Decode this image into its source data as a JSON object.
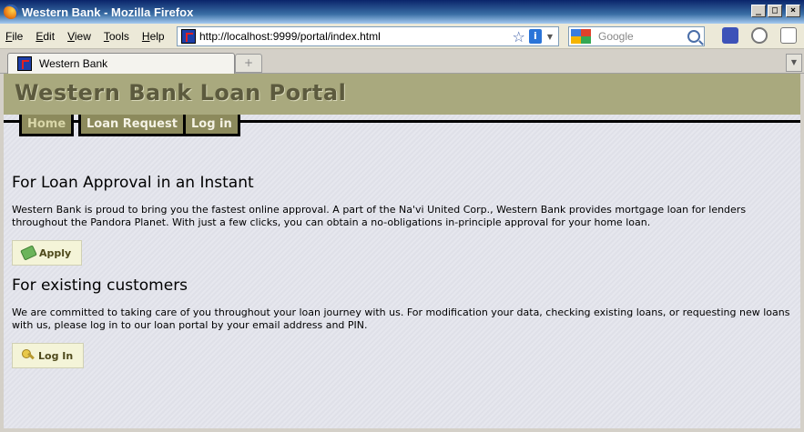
{
  "window": {
    "title": "Western Bank - Mozilla Firefox"
  },
  "menu": [
    "File",
    "Edit",
    "View",
    "Tools",
    "Help"
  ],
  "urlbar": {
    "url": "http://localhost:9999/portal/index.html"
  },
  "search": {
    "placeholder": "Google"
  },
  "tabs": [
    {
      "label": "Western Bank"
    }
  ],
  "page": {
    "header_title": "Western Bank Loan Portal",
    "nav": [
      "Home",
      "Loan Request",
      "Log in"
    ],
    "section1": {
      "title": "For Loan Approval in an Instant",
      "text": "Western Bank is proud to bring you the fastest online approval. A part of the Na'vi United Corp., Western Bank provides mortgage loan for lenders throughout the Pandora Planet. With just a few clicks, you can obtain a no-obligations in-principle approval for your home loan.",
      "button": "Apply"
    },
    "section2": {
      "title": "For existing customers",
      "text": "We are committed to taking care of you throughout your loan journey with us. For modification your data, checking existing loans, or requesting new loans with us, please log in to our loan portal by your email address and PIN.",
      "button": "Log In"
    }
  }
}
